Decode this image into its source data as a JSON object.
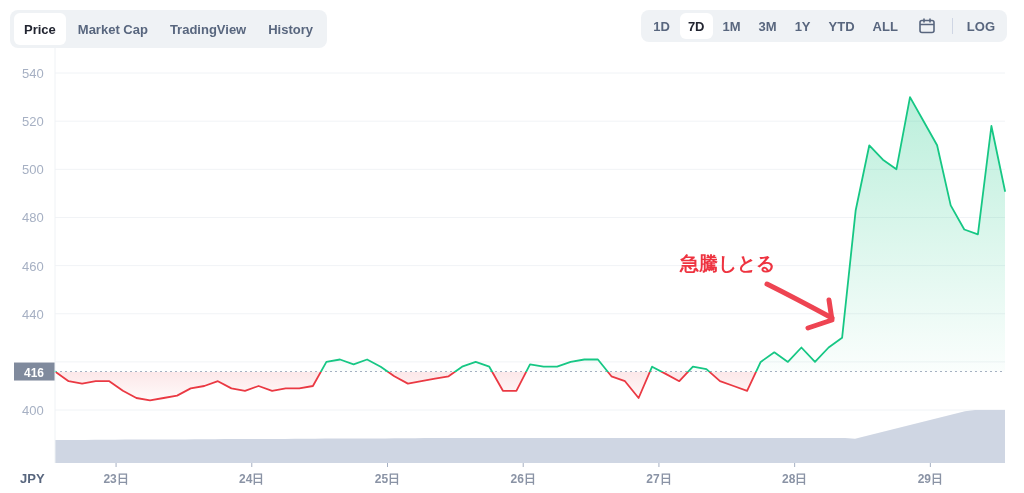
{
  "tabs": [
    {
      "label": "Price",
      "selected": true
    },
    {
      "label": "Market Cap",
      "selected": false
    },
    {
      "label": "TradingView",
      "selected": false
    },
    {
      "label": "History",
      "selected": false
    }
  ],
  "ranges": [
    {
      "label": "1D",
      "selected": false
    },
    {
      "label": "7D",
      "selected": true
    },
    {
      "label": "1M",
      "selected": false
    },
    {
      "label": "3M",
      "selected": false
    },
    {
      "label": "1Y",
      "selected": false
    },
    {
      "label": "YTD",
      "selected": false
    },
    {
      "label": "ALL",
      "selected": false
    }
  ],
  "log_toggle": {
    "label": "LOG"
  },
  "chart": {
    "currency": "JPY",
    "note": "急騰しとる",
    "chart_data": {
      "type": "area",
      "grid": true,
      "xlim": [
        22.55,
        29.55
      ],
      "ylim": [
        378,
        550.4
      ],
      "yticks": [
        400,
        440,
        460,
        480,
        500,
        520,
        540
      ],
      "xticks": [
        {
          "value": 23,
          "label": "23日"
        },
        {
          "value": 24,
          "label": "24日"
        },
        {
          "value": 25,
          "label": "25日"
        },
        {
          "value": 26,
          "label": "26日"
        },
        {
          "value": 27,
          "label": "27日"
        },
        {
          "value": 28,
          "label": "28日"
        },
        {
          "value": 29,
          "label": "29日"
        }
      ],
      "x": [
        22.55,
        22.65,
        22.75,
        22.85,
        22.95,
        23.05,
        23.15,
        23.25,
        23.35,
        23.45,
        23.55,
        23.65,
        23.75,
        23.85,
        23.95,
        24.05,
        24.15,
        24.25,
        24.35,
        24.45,
        24.55,
        24.65,
        24.75,
        24.85,
        24.95,
        25.05,
        25.15,
        25.25,
        25.35,
        25.45,
        25.55,
        25.65,
        25.75,
        25.85,
        25.95,
        26.05,
        26.15,
        26.25,
        26.35,
        26.45,
        26.55,
        26.65,
        26.75,
        26.85,
        26.95,
        27.05,
        27.15,
        27.25,
        27.35,
        27.45,
        27.55,
        27.65,
        27.75,
        27.85,
        27.95,
        28.05,
        28.15,
        28.25,
        28.35,
        28.45,
        28.55,
        28.65,
        28.75,
        28.85,
        28.95,
        29.05,
        29.15,
        29.25,
        29.35,
        29.45,
        29.55
      ],
      "series": [
        {
          "color": "#16c784",
          "values": [
            416,
            412,
            411,
            412,
            412,
            408,
            405,
            404,
            405,
            406,
            409,
            410,
            412,
            409,
            408,
            410,
            408,
            409,
            409,
            410,
            420,
            421,
            419,
            421,
            418,
            414,
            411,
            412,
            413,
            414,
            418,
            420,
            418,
            408,
            408,
            419,
            418,
            418,
            420,
            421,
            421,
            414,
            412,
            405,
            418,
            415,
            412,
            418,
            417,
            412,
            410,
            408,
            420,
            424,
            420,
            426,
            420,
            426,
            430,
            483,
            510,
            504,
            500,
            530,
            520,
            510,
            485,
            475,
            473,
            518,
            491
          ]
        }
      ],
      "ref_lines": [
        {
          "axis": "y",
          "value": 416,
          "label": "416"
        }
      ]
    }
  }
}
